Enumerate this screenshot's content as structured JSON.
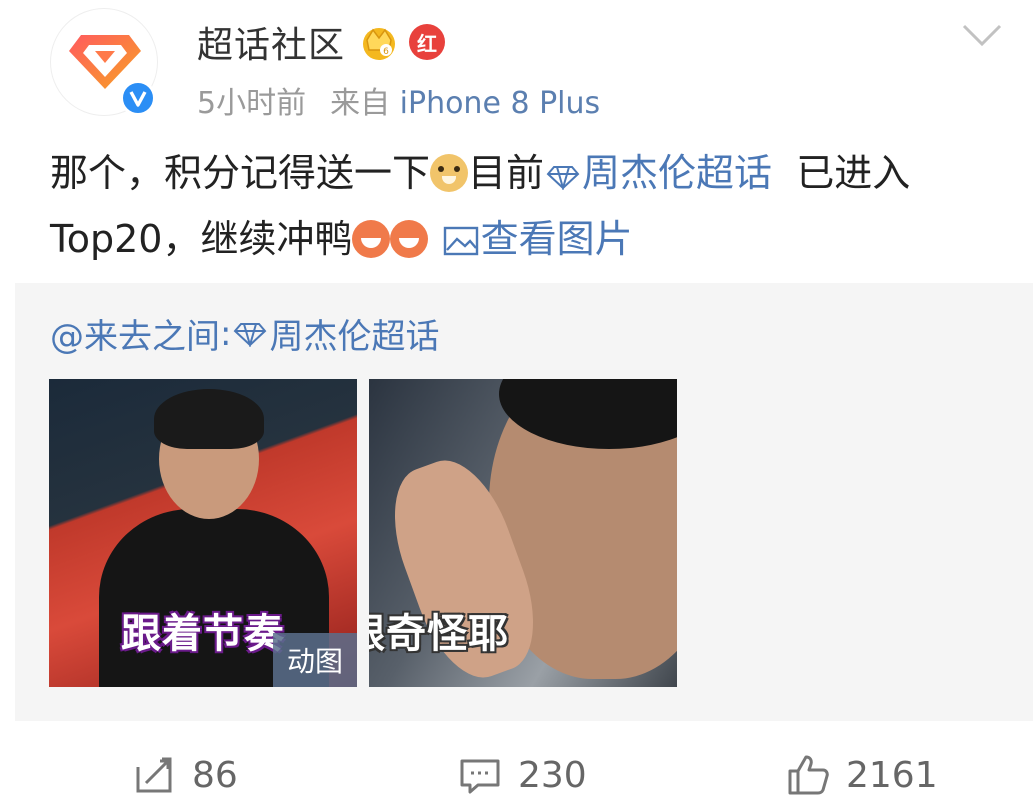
{
  "author": {
    "name": "超话社区",
    "badge_red_label": "红",
    "crown_icon": "crown-badge-icon"
  },
  "meta": {
    "time": "5小时前",
    "source_prefix": "来自",
    "device": "iPhone 8 Plus"
  },
  "content": {
    "part1": "那个，积分记得送一下",
    "part2": "目前",
    "topic": "周杰伦超话",
    "part3": "已进入",
    "part4": "Top20，继续冲鸭",
    "view_image": "查看图片"
  },
  "repost": {
    "mention": "@来去之间",
    "separator": ":",
    "topic": "周杰伦超话",
    "images": [
      {
        "caption": "跟着节奏",
        "tag": "动图"
      },
      {
        "caption": "跟奇怪耶"
      }
    ]
  },
  "actions": {
    "repost_count": "86",
    "comment_count": "230",
    "like_count": "2161"
  },
  "colors": {
    "link": "#4b78b6",
    "verified": "#2b8ef5",
    "red_badge": "#e8413c"
  }
}
